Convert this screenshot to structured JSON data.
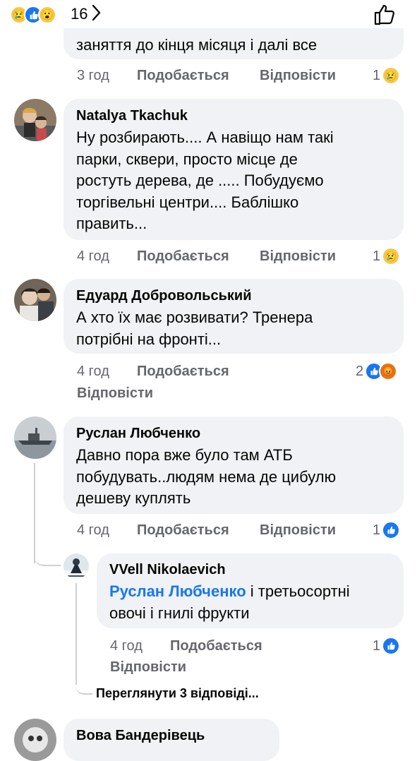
{
  "top_bar": {
    "reaction_count": "16",
    "reactions": [
      "sad",
      "like",
      "wow"
    ],
    "chevron": "chevron-right-icon",
    "like_icon": "thumbs-up-outline-icon"
  },
  "comments": [
    {
      "text_lines": [
        "заняття до кінця місяця і далі все"
      ],
      "time": "3 год",
      "like_label": "Подобається",
      "reply_label": "Відповісти",
      "reaction_count": "1",
      "reactions": [
        "sad"
      ]
    },
    {
      "author": "Natalya  Tkachuk",
      "text_lines": [
        "Ну розбирають.... А навіщо нам такі",
        "парки, сквери, просто місце де",
        "ростуть дерева, де ..... Побудуємо",
        "торгівельні центри.... Баблішко",
        "править..."
      ],
      "time": "4 год",
      "like_label": "Подобається",
      "reply_label": "Відповісти",
      "reaction_count": "1",
      "reactions": [
        "sad"
      ]
    },
    {
      "author": "Едуард Добровольський",
      "text_lines": [
        "А хто їх має розвивати? Тренера",
        "потрібні на фронті..."
      ],
      "time": "4 год",
      "like_label": "Подобається",
      "reply_label": "Відповісти",
      "reaction_count": "2",
      "reactions": [
        "like",
        "angry"
      ]
    },
    {
      "author": "Руслан Любченко",
      "text_lines": [
        "Давно пора вже було там АТБ",
        "побудувать..людям нема де цибулю",
        "дешеву куплять"
      ],
      "time": "4 год",
      "like_label": "Подобається",
      "reply_label": "Відповісти",
      "reaction_count": "1",
      "reactions": [
        "like"
      ]
    },
    {
      "author": "VVell Nikolaevich",
      "mention": "Руслан Любченко",
      "text_lines": [
        " і третьосортні",
        "овочі і гнилі фрукти"
      ],
      "time": "4 год",
      "like_label": "Подобається",
      "reply_label": "Відповісти",
      "reaction_count": "1",
      "reactions": [
        "like"
      ]
    },
    {
      "author": "Вова Бандерівець"
    }
  ],
  "view_replies": "Переглянути 3 відповіді..."
}
